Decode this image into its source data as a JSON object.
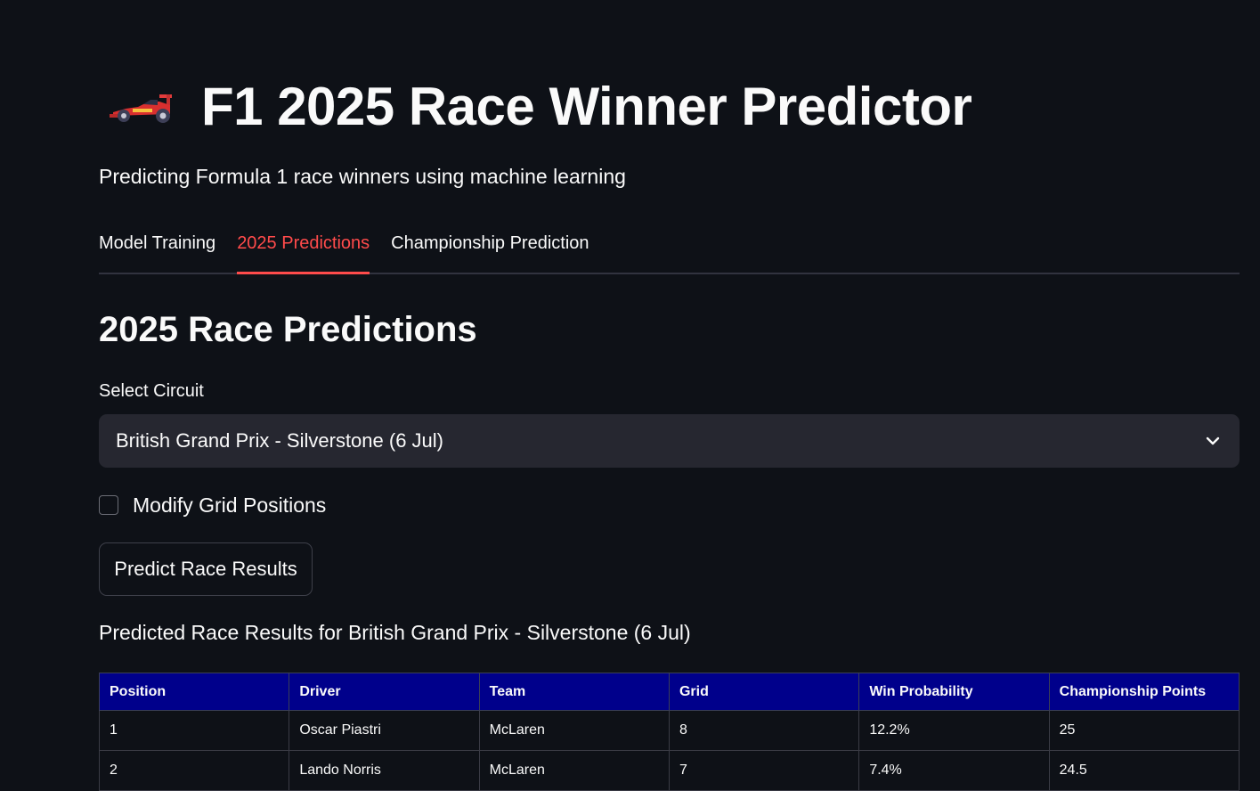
{
  "header": {
    "icon": "race-car-icon",
    "title": "F1 2025 Race Winner Predictor",
    "subtitle": "Predicting Formula 1 race winners using machine learning"
  },
  "tabs": [
    {
      "label": "Model Training",
      "active": false
    },
    {
      "label": "2025 Predictions",
      "active": true
    },
    {
      "label": "Championship Prediction",
      "active": false
    }
  ],
  "section": {
    "title": "2025 Race Predictions"
  },
  "circuit_select": {
    "label": "Select Circuit",
    "value": "British Grand Prix - Silverstone (6 Jul)"
  },
  "grid_checkbox": {
    "label": "Modify Grid Positions",
    "checked": false
  },
  "predict_button": {
    "label": "Predict Race Results"
  },
  "results": {
    "caption": "Predicted Race Results for British Grand Prix - Silverstone (6 Jul)",
    "columns": [
      "Position",
      "Driver",
      "Team",
      "Grid",
      "Win Probability",
      "Championship Points"
    ],
    "rows": [
      [
        "1",
        "Oscar Piastri",
        "McLaren",
        "8",
        "12.2%",
        "25"
      ],
      [
        "2",
        "Lando Norris",
        "McLaren",
        "7",
        "7.4%",
        "24.5"
      ]
    ]
  },
  "colors": {
    "background": "#0e1117",
    "accent": "#ff4b4b",
    "table_header": "#00008b",
    "input_bg": "#262730"
  }
}
